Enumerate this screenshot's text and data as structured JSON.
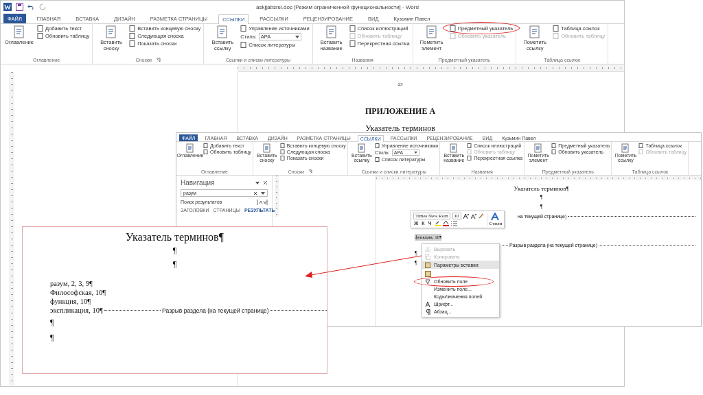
{
  "window": {
    "title": "askjjabsrel.doc [Режим ограниченной функциональности] - Word"
  },
  "tabs": [
    {
      "label": "ФАЙЛ",
      "kind": "file",
      "selected": false
    },
    {
      "label": "ГЛАВНАЯ",
      "kind": "tab",
      "selected": false
    },
    {
      "label": "ВСТАВКА",
      "kind": "tab",
      "selected": false
    },
    {
      "label": "ДИЗАЙН",
      "kind": "tab",
      "selected": false
    },
    {
      "label": "РАЗМЕТКА СТРАНИЦЫ",
      "kind": "tab",
      "selected": false
    },
    {
      "label": "ССЫЛКИ",
      "kind": "tab",
      "selected": true
    },
    {
      "label": "РАССЫЛКИ",
      "kind": "tab",
      "selected": false
    },
    {
      "label": "РЕЦЕНЗИРОВАНИЕ",
      "kind": "tab",
      "selected": false
    },
    {
      "label": "ВИД",
      "kind": "tab",
      "selected": false
    },
    {
      "label": "Кузьмин Павел",
      "kind": "user",
      "selected": false
    }
  ],
  "ribbon": {
    "groups": [
      {
        "label": "Оглавление",
        "large": [
          "Оглавление"
        ],
        "small": [
          {
            "kind": "button",
            "label": "Добавить текст",
            "disabled": false,
            "circled": false
          },
          {
            "kind": "button",
            "label": "Обновить таблицу",
            "disabled": false,
            "circled": false
          }
        ]
      },
      {
        "label": "Сноски",
        "launcher": true,
        "large": [
          "Вставить сноску"
        ],
        "small": [
          {
            "kind": "button",
            "label": "Вставить концевую сноску",
            "disabled": false,
            "circled": false
          },
          {
            "kind": "button",
            "label": "Следующая сноска",
            "disabled": false,
            "circled": false
          },
          {
            "kind": "button",
            "label": "Показать сноски",
            "disabled": false,
            "circled": false
          }
        ]
      },
      {
        "label": "Ссылки и списки литературы",
        "large": [
          "Вставить ссылку"
        ],
        "small": [
          {
            "kind": "button",
            "label": "Управление источниками",
            "disabled": false,
            "circled": false
          },
          {
            "kind": "dropdown",
            "label": "Стиль:",
            "value": "APA",
            "disabled": false,
            "circled": false
          },
          {
            "kind": "button",
            "label": "Список литературы",
            "disabled": false,
            "circled": false
          }
        ]
      },
      {
        "label": "Названия",
        "large": [
          "Вставить название"
        ],
        "small": [
          {
            "kind": "button",
            "label": "Список иллюстраций",
            "disabled": false,
            "circled": false
          },
          {
            "kind": "button",
            "label": "Обновить таблицу",
            "disabled": true,
            "circled": false
          },
          {
            "kind": "button",
            "label": "Перекрестная ссылка",
            "disabled": false,
            "circled": false
          }
        ]
      },
      {
        "label": "Предметный указатель",
        "large": [
          "Пометить элемент"
        ],
        "small": [
          {
            "kind": "button",
            "label": "Предметный указатель",
            "disabled": false,
            "circled": true
          },
          {
            "kind": "button",
            "label": "Обновить указатель",
            "disabled": true,
            "circled": false
          }
        ]
      },
      {
        "label": "Таблица ссылок",
        "large": [
          "Пометить ссылку"
        ],
        "small": [
          {
            "kind": "button",
            "label": "Таблица ссылок",
            "disabled": false,
            "circled": false
          },
          {
            "kind": "button",
            "label": "Обновить таблицу",
            "disabled": true,
            "circled": false
          }
        ]
      }
    ]
  },
  "document": {
    "page_number": "23",
    "heading": "ПРИЛОЖЕНИЕ А",
    "subheading": "Указатель терминов"
  },
  "inset": {
    "tabs": [
      {
        "label": "ФАЙЛ",
        "kind": "file",
        "selected": false
      },
      {
        "label": "ГЛАВНАЯ",
        "kind": "tab",
        "selected": false
      },
      {
        "label": "ВСТАВКА",
        "kind": "tab",
        "selected": false
      },
      {
        "label": "ДИЗАЙН",
        "kind": "tab",
        "selected": false
      },
      {
        "label": "РАЗМЕТКА СТРАНИЦЫ",
        "kind": "tab",
        "selected": false
      },
      {
        "label": "ССЫЛКИ",
        "kind": "tab",
        "selected": true
      },
      {
        "label": "РАССЫЛКИ",
        "kind": "tab",
        "selected": false
      },
      {
        "label": "РЕЦЕНЗИРОВАНИЕ",
        "kind": "tab",
        "selected": false
      },
      {
        "label": "ВИД",
        "kind": "tab",
        "selected": false
      },
      {
        "label": "Кузьмин Павел",
        "kind": "user",
        "selected": false
      }
    ],
    "ribbon": {
      "groups": [
        {
          "label": "Оглавление",
          "large": [
            "Оглавление"
          ],
          "small": [
            {
              "kind": "button",
              "label": "Добавить текст",
              "disabled": false,
              "circled": false
            },
            {
              "kind": "button",
              "label": "Обновить таблицу",
              "disabled": false,
              "circled": false
            }
          ]
        },
        {
          "label": "Сноски",
          "launcher": true,
          "large": [
            "Вставить сноску"
          ],
          "small": [
            {
              "kind": "button",
              "label": "Вставить концевую сноску",
              "disabled": false,
              "circled": false
            },
            {
              "kind": "button",
              "label": "Следующая сноска",
              "disabled": false,
              "circled": false
            },
            {
              "kind": "button",
              "label": "Показать сноски",
              "disabled": false,
              "circled": false
            }
          ]
        },
        {
          "label": "Ссылки и списки литературы",
          "large": [
            "Вставить ссылку"
          ],
          "small": [
            {
              "kind": "button",
              "label": "Управление источниками",
              "disabled": false,
              "circled": false
            },
            {
              "kind": "dropdown",
              "label": "Стиль:",
              "value": "APA",
              "disabled": false,
              "circled": false
            },
            {
              "kind": "button",
              "label": "Список литературы",
              "disabled": false,
              "circled": false
            }
          ]
        },
        {
          "label": "Названия",
          "large": [
            "Вставить название"
          ],
          "small": [
            {
              "kind": "button",
              "label": "Список иллюстраций",
              "disabled": false,
              "circled": false
            },
            {
              "kind": "button",
              "label": "Обновить таблицу",
              "disabled": true,
              "circled": false
            },
            {
              "kind": "button",
              "label": "Перекрестная ссылка",
              "disabled": false,
              "circled": false
            }
          ]
        },
        {
          "label": "Предметный указатель",
          "large": [
            "Пометить элемент"
          ],
          "small": [
            {
              "kind": "button",
              "label": "Предметный указатель",
              "disabled": false,
              "circled": false
            },
            {
              "kind": "button",
              "label": "Обновить указатель",
              "disabled": false,
              "circled": false
            }
          ]
        },
        {
          "label": "Таблица ссылок",
          "large": [
            "Пометить ссылку"
          ],
          "small": [
            {
              "kind": "button",
              "label": "Таблица ссылок",
              "disabled": false,
              "circled": false
            },
            {
              "kind": "button",
              "label": "Обновить таблицу",
              "disabled": true,
              "circled": false
            }
          ]
        }
      ]
    },
    "navigation": {
      "title": "Навигация",
      "search": {
        "value": "разум"
      },
      "results_label": "Поиск результатов",
      "tabs": [
        {
          "label": "ЗАГОЛОВКИ",
          "selected": false
        },
        {
          "label": "СТРАНИЦЫ",
          "selected": false
        },
        {
          "label": "РЕЗУЛЬТАТЫ",
          "selected": true
        }
      ]
    },
    "page": {
      "title": "Указатель терминов¶",
      "marks": [
        "¶",
        "¶"
      ],
      "break_tail": "на текущей странице)",
      "selected_line": "функция, 10¶",
      "section_break": "Разрыв раздела (на текущей странице)",
      "after": [
        "¶",
        "¶"
      ]
    },
    "mini_toolbar": {
      "font": "Times New Rom",
      "size": "10",
      "format_buttons": [
        "Ж",
        "К",
        "Ч"
      ],
      "styles_label": "Стили"
    },
    "context_menu": {
      "items": [
        {
          "kind": "cut",
          "label": "Вырезать",
          "disabled": true,
          "selected": false,
          "circled": false
        },
        {
          "kind": "copy",
          "label": "Копировать",
          "disabled": true,
          "selected": false,
          "circled": false
        },
        {
          "kind": "paste",
          "label": "Параметры вставки:",
          "disabled": false,
          "selected": true,
          "circled": false
        },
        {
          "kind": "paste-option",
          "disabled": false,
          "selected": false,
          "circled": false
        },
        {
          "kind": "update",
          "label": "Обновить поле",
          "disabled": false,
          "selected": false,
          "circled": true
        },
        {
          "kind": "plain",
          "label": "Изменить поле...",
          "disabled": false,
          "selected": false,
          "circled": false
        },
        {
          "kind": "plain",
          "label": "Коды/значения полей",
          "disabled": false,
          "selected": false,
          "circled": false
        },
        {
          "kind": "font",
          "label": "Шрифт...",
          "disabled": false,
          "selected": false,
          "circled": false
        },
        {
          "kind": "paragraph",
          "label": "Абзац...",
          "disabled": false,
          "selected": false,
          "circled": false
        }
      ]
    }
  },
  "zoom": {
    "title": "Указатель терминов¶",
    "marks": [
      "¶",
      "¶"
    ],
    "entries": [
      "разум, 2, 3, 9¶",
      "Философская, 10¶",
      "функция, 10¶",
      "экспликация, 10¶"
    ],
    "section_break": "Разрыв раздела (на текущей странице)",
    "after": [
      "¶",
      "¶"
    ]
  }
}
